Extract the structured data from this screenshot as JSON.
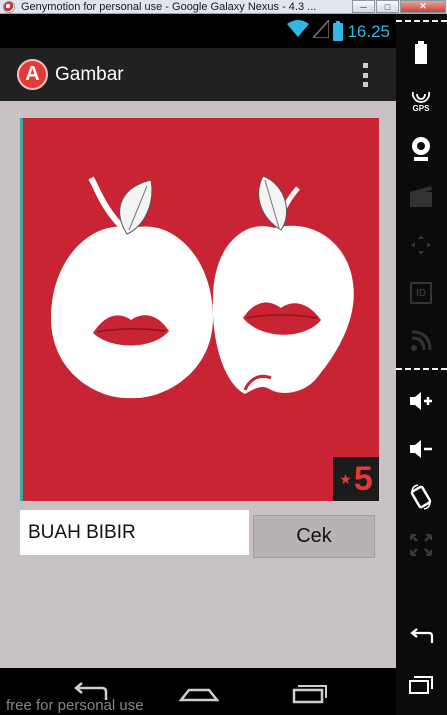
{
  "host_window": {
    "title": "Genymotion for personal use - Google Galaxy Nexus - 4.3 ...",
    "minimize_label": "─",
    "maximize_label": "□",
    "close_label": "✕"
  },
  "status_bar": {
    "time": "16.25"
  },
  "action_bar": {
    "app_icon_letter": "A",
    "title": "Gambar"
  },
  "puzzle": {
    "level_star": "★",
    "level": "5"
  },
  "answer": {
    "value": "BUAH BIBIR",
    "check_label": "Cek"
  },
  "watermark": "free for personal use",
  "side_panel": {
    "gps_label": "GPS",
    "id_label": "ID"
  },
  "colors": {
    "puzzle_bg": "#c92434",
    "status_accent": "#33b5e5",
    "content_bg": "#c8c2c2"
  }
}
